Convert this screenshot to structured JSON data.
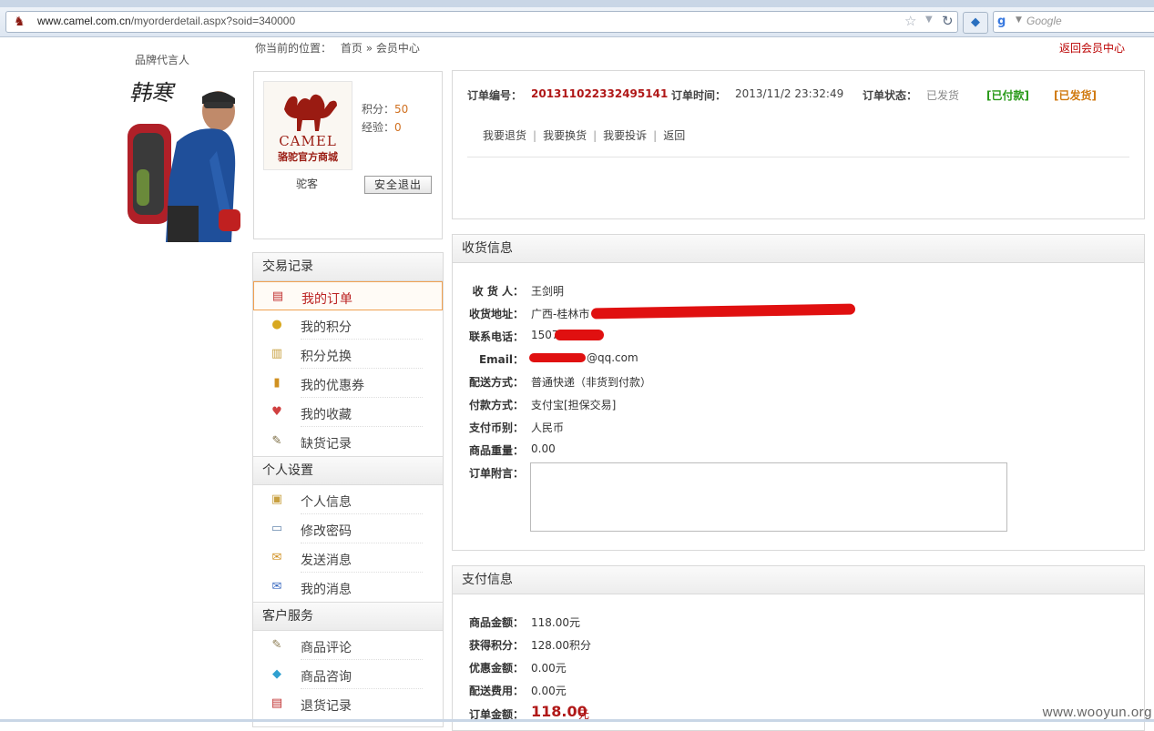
{
  "browser": {
    "url_domain": "www.camel.com.cn",
    "url_path": "/myorderdetail.aspx?soid=340000",
    "search_placeholder": "Google"
  },
  "breadcrumb": {
    "label": "你当前的位置：",
    "home": "首页",
    "sep": "»",
    "current": "会员中心"
  },
  "back_link": "返回会员中心",
  "ambassador": {
    "caption": "品牌代言人",
    "signature": "韩寒"
  },
  "user": {
    "logo_brand": "CAMEL",
    "logo_sub": "骆驼官方商城",
    "points_label": "积分：",
    "points_value": "50",
    "exp_label": "经验：",
    "exp_value": "0",
    "name": "驼客",
    "logout": "安全退出"
  },
  "menu": {
    "sections": [
      {
        "title": "交易记录",
        "items": [
          {
            "label": "我的订单",
            "icon": "order-icon"
          },
          {
            "label": "我的积分",
            "icon": "coins-icon"
          },
          {
            "label": "积分兑换",
            "icon": "exchange-icon"
          },
          {
            "label": "我的优惠券",
            "icon": "coupon-icon"
          },
          {
            "label": "我的收藏",
            "icon": "favorite-icon"
          },
          {
            "label": "缺货记录",
            "icon": "notepad-icon"
          }
        ]
      },
      {
        "title": "个人设置",
        "items": [
          {
            "label": "个人信息",
            "icon": "id-card-icon"
          },
          {
            "label": "修改密码",
            "icon": "keyboard-icon"
          },
          {
            "label": "发送消息",
            "icon": "send-message-icon"
          },
          {
            "label": "我的消息",
            "icon": "message-icon"
          }
        ]
      },
      {
        "title": "客户服务",
        "items": [
          {
            "label": "商品评论",
            "icon": "comment-icon"
          },
          {
            "label": "商品咨询",
            "icon": "chat-bubble-icon"
          },
          {
            "label": "退货记录",
            "icon": "return-icon"
          }
        ]
      }
    ]
  },
  "order": {
    "no_label": "订单编号：",
    "no_value": "201311022332495141",
    "time_label": "订单时间：",
    "time_value": "2013/11/2 23:32:49",
    "status_label": "订单状态：",
    "status_value": "已发货",
    "paid_badge": "[已付款]",
    "shipped_badge": "[已发货]",
    "links": [
      "我要退货",
      "我要换货",
      "我要投诉",
      "返回"
    ],
    "colors": {
      "order_no": "#b01818",
      "paid": "#2a9a1a",
      "shipped": "#d07a10"
    }
  },
  "shipping": {
    "title": "收货信息",
    "rows": [
      {
        "k": "收 货 人：",
        "v": "王剑明"
      },
      {
        "k": "收货地址：",
        "v": "广西-桂林市"
      },
      {
        "k": "联系电话：",
        "v": "1507"
      },
      {
        "k": "Email：",
        "v": "@qq.com"
      },
      {
        "k": "配送方式：",
        "v": "普通快递（非货到付款）"
      },
      {
        "k": "付款方式：",
        "v": "支付宝[担保交易]"
      },
      {
        "k": "支付币别：",
        "v": "人民币"
      },
      {
        "k": "商品重量：",
        "v": "0.00"
      },
      {
        "k": "订单附言：",
        "v": ""
      }
    ]
  },
  "payment": {
    "title": "支付信息",
    "rows": [
      {
        "k": "商品金额：",
        "v": "118.00元"
      },
      {
        "k": "获得积分：",
        "v": "128.00积分"
      },
      {
        "k": "优惠金额：",
        "v": "0.00元"
      },
      {
        "k": "配送费用：",
        "v": "0.00元"
      },
      {
        "k": "订单金额：",
        "v": "118.00",
        "unit": "元"
      }
    ]
  },
  "watermark": "www.wooyun.org"
}
